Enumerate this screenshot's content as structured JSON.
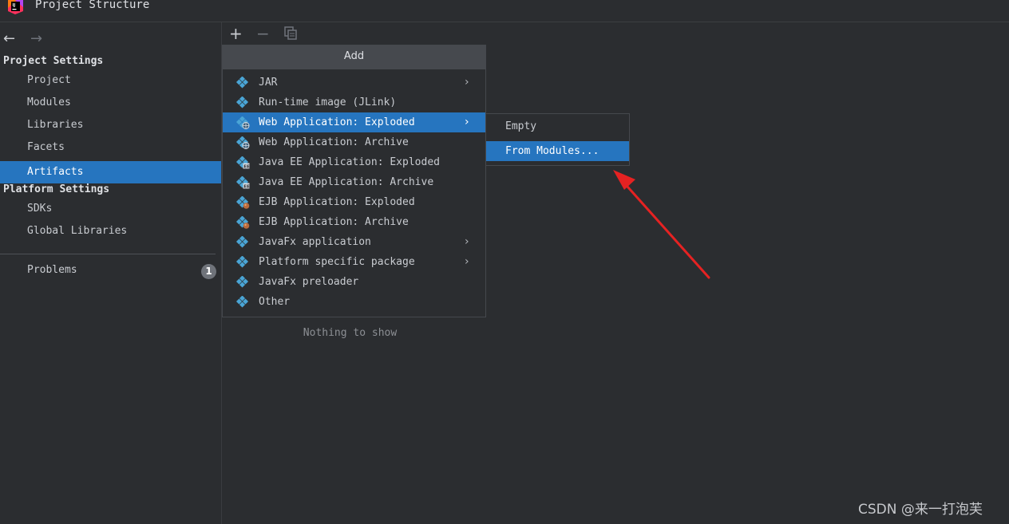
{
  "window": {
    "title": "Project Structure",
    "logo_icon": "intellij-idea-icon"
  },
  "nav_buttons": {
    "back_icon": "arrow-left-icon",
    "forward_icon": "arrow-right-icon"
  },
  "sidebar": {
    "project_settings_header": "Project Settings",
    "project_settings_items": [
      {
        "label": "Project",
        "selected": false
      },
      {
        "label": "Modules",
        "selected": false
      },
      {
        "label": "Libraries",
        "selected": false
      },
      {
        "label": "Facets",
        "selected": false
      },
      {
        "label": "Artifacts",
        "selected": true
      }
    ],
    "platform_settings_header": "Platform Settings",
    "platform_settings_items": [
      {
        "label": "SDKs"
      },
      {
        "label": "Global Libraries"
      }
    ],
    "problems": {
      "label": "Problems",
      "count": "1"
    }
  },
  "toolbar": {
    "add_icon": "plus-icon",
    "remove_icon": "minus-icon",
    "copy_icon": "copy-icon"
  },
  "artifacts_list": {
    "empty_text": "Nothing to show"
  },
  "add_popup": {
    "title": "Add",
    "items": [
      {
        "label": "JAR",
        "icon": "artifact-icon",
        "submenu": true,
        "selected": false
      },
      {
        "label": "Run-time image (JLink)",
        "icon": "artifact-icon",
        "submenu": false,
        "selected": false
      },
      {
        "label": "Web Application: Exploded",
        "icon": "web-artifact-icon",
        "submenu": true,
        "selected": true
      },
      {
        "label": "Web Application: Archive",
        "icon": "web-artifact-icon",
        "submenu": false,
        "selected": false
      },
      {
        "label": "Java EE Application: Exploded",
        "icon": "javaee-artifact-icon",
        "submenu": false,
        "selected": false
      },
      {
        "label": "Java EE Application: Archive",
        "icon": "javaee-artifact-icon",
        "submenu": false,
        "selected": false
      },
      {
        "label": "EJB Application: Exploded",
        "icon": "ejb-artifact-icon",
        "submenu": false,
        "selected": false
      },
      {
        "label": "EJB Application: Archive",
        "icon": "ejb-artifact-icon",
        "submenu": false,
        "selected": false
      },
      {
        "label": "JavaFx application",
        "icon": "artifact-icon",
        "submenu": true,
        "selected": false
      },
      {
        "label": "Platform specific package",
        "icon": "artifact-icon",
        "submenu": true,
        "selected": false
      },
      {
        "label": "JavaFx preloader",
        "icon": "artifact-icon",
        "submenu": false,
        "selected": false
      },
      {
        "label": "Other",
        "icon": "artifact-icon",
        "submenu": false,
        "selected": false
      }
    ]
  },
  "sub_popup": {
    "items": [
      {
        "label": "Empty",
        "selected": false
      },
      {
        "label": "From Modules...",
        "selected": true
      }
    ]
  },
  "watermark": "CSDN @来一打泡芙",
  "colors": {
    "selection": "#2675bf",
    "background": "#2b2d30",
    "annotation_arrow": "#e52222",
    "artifact_icon": "#4aa5d6"
  }
}
